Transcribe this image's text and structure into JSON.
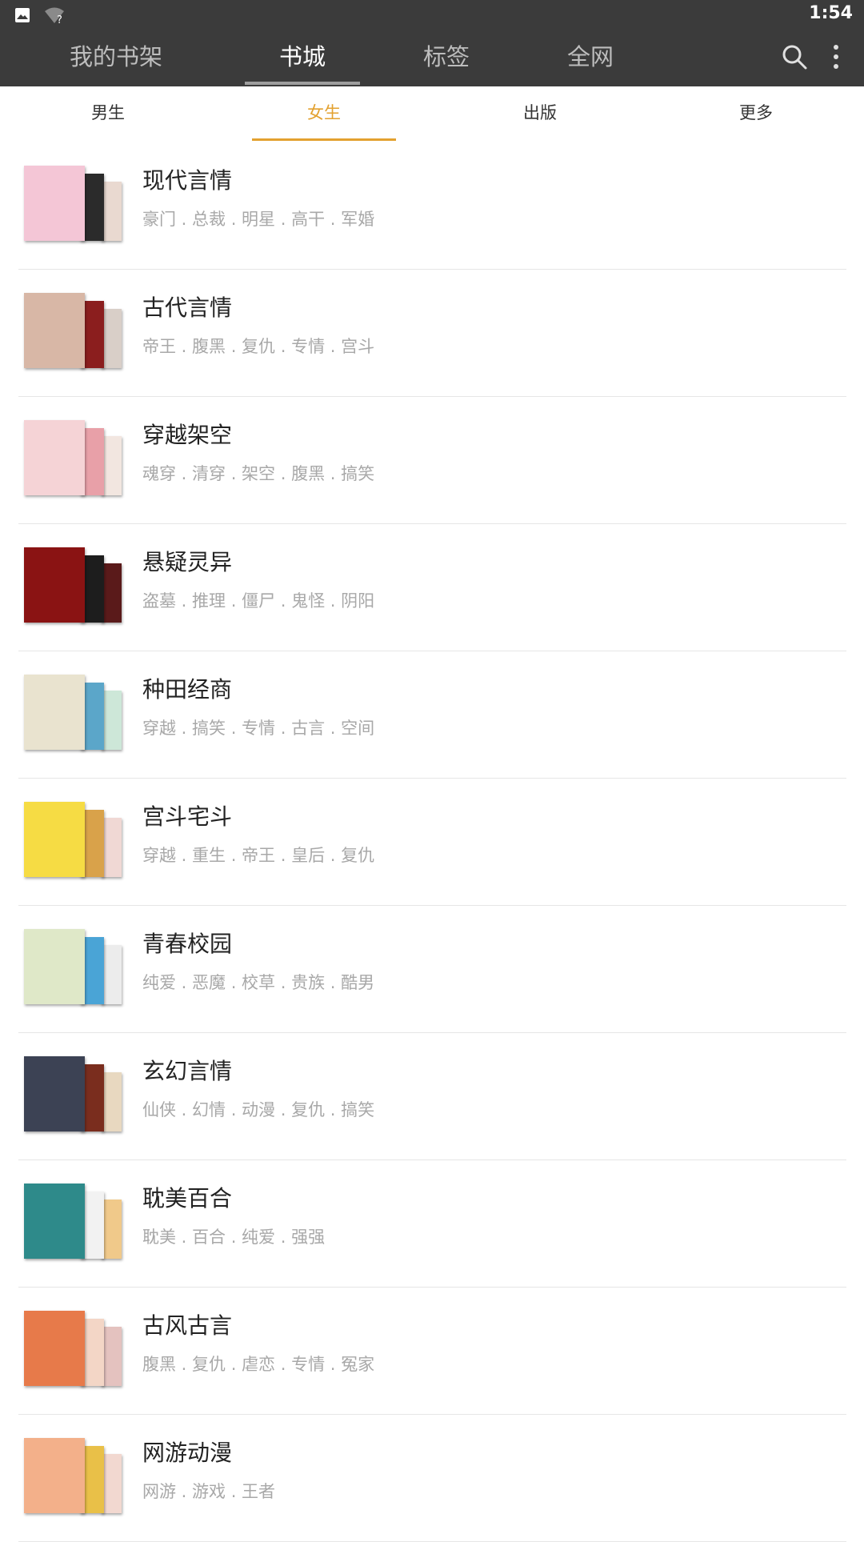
{
  "status_bar": {
    "time": "1:54",
    "icons": [
      "image-icon",
      "wifi-unknown-icon"
    ]
  },
  "top_nav": {
    "tabs": [
      {
        "label": "我的书架",
        "active": false
      },
      {
        "label": "书城",
        "active": true
      },
      {
        "label": "标签",
        "active": false
      },
      {
        "label": "全网",
        "active": false
      }
    ],
    "actions": [
      "search-icon",
      "more-vertical-icon"
    ]
  },
  "sub_tabs": [
    {
      "label": "男生",
      "active": false
    },
    {
      "label": "女生",
      "active": true
    },
    {
      "label": "出版",
      "active": false
    },
    {
      "label": "更多",
      "active": false
    }
  ],
  "categories": [
    {
      "title": "现代言情",
      "tags": "豪门 . 总裁 . 明星 . 高干 . 军婚",
      "colors": [
        "#f4c6d6",
        "#2b2b2b",
        "#e9d9d0"
      ]
    },
    {
      "title": "古代言情",
      "tags": "帝王 . 腹黑 . 复仇 . 专情 . 宫斗",
      "colors": [
        "#d8b7a6",
        "#8b1e1e",
        "#d9cfc8"
      ]
    },
    {
      "title": "穿越架空",
      "tags": "魂穿 . 清穿 . 架空 . 腹黑 . 搞笑",
      "colors": [
        "#f5d3d6",
        "#e8a0a8",
        "#f2e6e0"
      ]
    },
    {
      "title": "悬疑灵异",
      "tags": "盗墓 . 推理 . 僵尸 . 鬼怪 . 阴阳",
      "colors": [
        "#8a1313",
        "#1d1d1d",
        "#5a1a1a"
      ]
    },
    {
      "title": "种田经商",
      "tags": "穿越 . 搞笑 . 专情 . 古言 . 空间",
      "colors": [
        "#e9e3cf",
        "#5ba6c9",
        "#cde7d8"
      ]
    },
    {
      "title": "宫斗宅斗",
      "tags": "穿越 . 重生 . 帝王 . 皇后 . 复仇",
      "colors": [
        "#f6dc44",
        "#d9a24a",
        "#f0d8d4"
      ]
    },
    {
      "title": "青春校园",
      "tags": "纯爱 . 恶魔 . 校草 . 贵族 . 酷男",
      "colors": [
        "#dfe8c8",
        "#4aa4d6",
        "#ececec"
      ]
    },
    {
      "title": "玄幻言情",
      "tags": "仙侠 . 幻情 . 动漫 . 复仇 . 搞笑",
      "colors": [
        "#3c4254",
        "#7a2d1e",
        "#e8d8c0"
      ]
    },
    {
      "title": "耽美百合",
      "tags": "耽美 . 百合 . 纯爱 . 强强",
      "colors": [
        "#2e8a8a",
        "#f2f2f2",
        "#f0c98a"
      ]
    },
    {
      "title": "古风古言",
      "tags": "腹黑 . 复仇 . 虐恋 . 专情 . 冤家",
      "colors": [
        "#e77a4a",
        "#f3d6c6",
        "#e4c2bf"
      ]
    },
    {
      "title": "网游动漫",
      "tags": "网游 . 游戏 . 王者",
      "colors": [
        "#f3b08a",
        "#e9c048",
        "#f2d8d0"
      ]
    }
  ]
}
